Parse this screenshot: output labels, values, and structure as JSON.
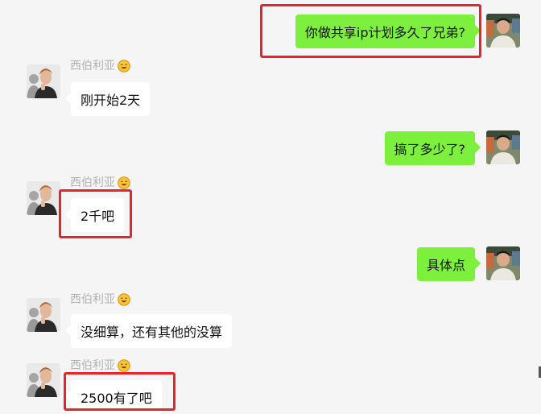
{
  "chat": {
    "contact_name": "西伯利亚",
    "messages": [
      {
        "side": "out",
        "text": "你做共享ip计划多久了兄弟?"
      },
      {
        "side": "in",
        "text": "刚开始2天"
      },
      {
        "side": "out",
        "text": "搞了多少了?"
      },
      {
        "side": "in",
        "text": "2千吧"
      },
      {
        "side": "out",
        "text": "具体点"
      },
      {
        "side": "in",
        "text": "没细算，还有其他的没算"
      },
      {
        "side": "in",
        "text": "2500有了吧"
      }
    ]
  },
  "colors": {
    "background": "#f5f5f5",
    "outgoing_bubble": "#7cf03c",
    "incoming_bubble": "#ffffff",
    "highlight": "#e8242b",
    "name_text": "#b2b2b2"
  },
  "icons": {
    "emoji": "smiling-face-emoji",
    "self_avatar": "user-photo",
    "contact_avatar": "contact-photo"
  }
}
